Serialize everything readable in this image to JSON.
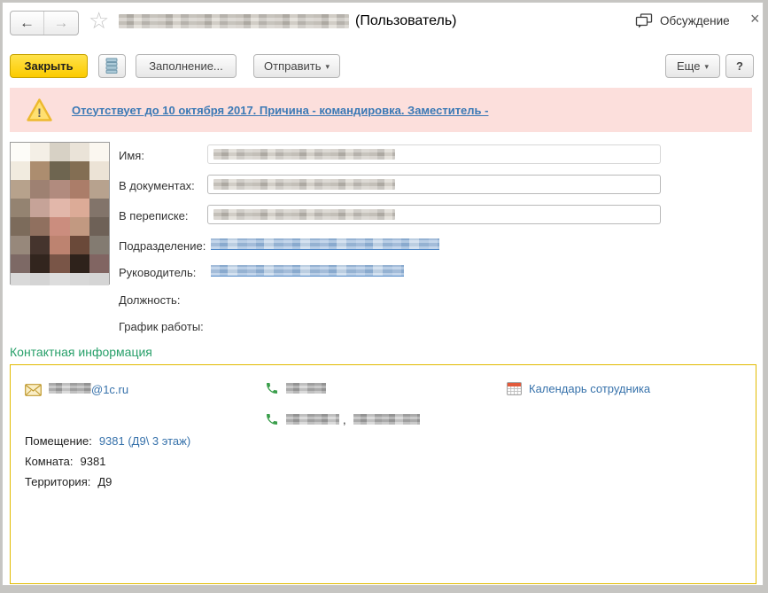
{
  "header": {
    "back_glyph": "←",
    "forward_glyph": "→",
    "star_glyph": "☆",
    "title_suffix": "(Пользователь)",
    "discussion": "Обсуждение",
    "close_glyph": "×"
  },
  "toolbar": {
    "close": "Закрыть",
    "fill": "Заполнение...",
    "send": "Отправить",
    "send_arrow": "▾",
    "more": "Еще",
    "more_arrow": "▾",
    "help": "?"
  },
  "banner": {
    "text": "Отсутствует до 10 октября 2017. Причина - командировка. Заместитель -",
    "icon_glyph": "!"
  },
  "form": {
    "name_label": "Имя:",
    "documents_label": "В документах:",
    "correspondence_label": "В переписке:",
    "department_label": "Подразделение:",
    "manager_label": "Руководитель:",
    "position_label": "Должность:",
    "schedule_label": "График работы:"
  },
  "contacts": {
    "title": "Контактная информация",
    "email_suffix": "@1c.ru",
    "phones_separator": ",",
    "calendar_link": "Календарь сотрудника",
    "room_label": "Помещение:",
    "room_value": "9381 (Д9\\ 3 этаж)",
    "kom_label": "Комната:",
    "kom_value": "9381",
    "terr_label": "Территория:",
    "terr_value": "Д9"
  },
  "colors": {
    "accent_yellow": "#fccb00",
    "banner_bg": "#fcdfdc",
    "link_blue": "#3772ab",
    "section_green": "#28a06a",
    "contact_border": "#e2bb00",
    "phone_green": "#3a9e4b",
    "calendar_red": "#e25a3c",
    "envelope_gold": "#c09a30"
  },
  "photo": {
    "pixels": [
      [
        "#fdfcf8",
        "#f4efe6",
        "#d7d1c5",
        "#eae3d8",
        "#fbf7f0"
      ],
      [
        "#f1ebdf",
        "#ac8d6f",
        "#6e6550",
        "#836e53",
        "#ece3d6"
      ],
      [
        "#b7a28c",
        "#9e8172",
        "#b18b7e",
        "#ab7d69",
        "#b7a28e"
      ],
      [
        "#948371",
        "#c6a398",
        "#e2b7aa",
        "#dcab97",
        "#82746a"
      ],
      [
        "#7c6b5b",
        "#90705f",
        "#cb8d7e",
        "#c29981",
        "#6e6157"
      ],
      [
        "#97887b",
        "#45342d",
        "#bd8370",
        "#6a4939",
        "#837b71"
      ],
      [
        "#7d6965",
        "#32251e",
        "#795547",
        "#2e221b",
        "#816562"
      ],
      [
        "#d9d9d9",
        "#d4d4d4",
        "#dddddd",
        "#d8d8d8",
        "#d5d5d5"
      ]
    ]
  }
}
